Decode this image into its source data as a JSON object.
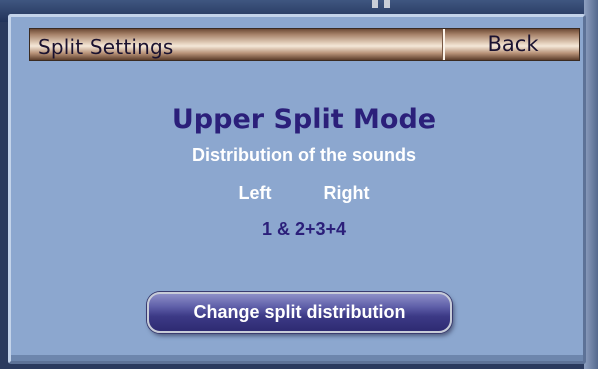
{
  "header": {
    "title": "Split Settings",
    "back_label": "Back"
  },
  "content": {
    "mode_title": "Upper Split Mode",
    "distribution_label": "Distribution of the sounds",
    "left_label": "Left",
    "right_label": "Right",
    "split_value": "1 & 2+3+4"
  },
  "button": {
    "change_label": "Change split distribution"
  },
  "colors": {
    "panel_background": "#8ca7cf",
    "title_text": "#2b1f7a",
    "header_bar": "#e9d6c3",
    "button_background": "#3c3a86"
  }
}
